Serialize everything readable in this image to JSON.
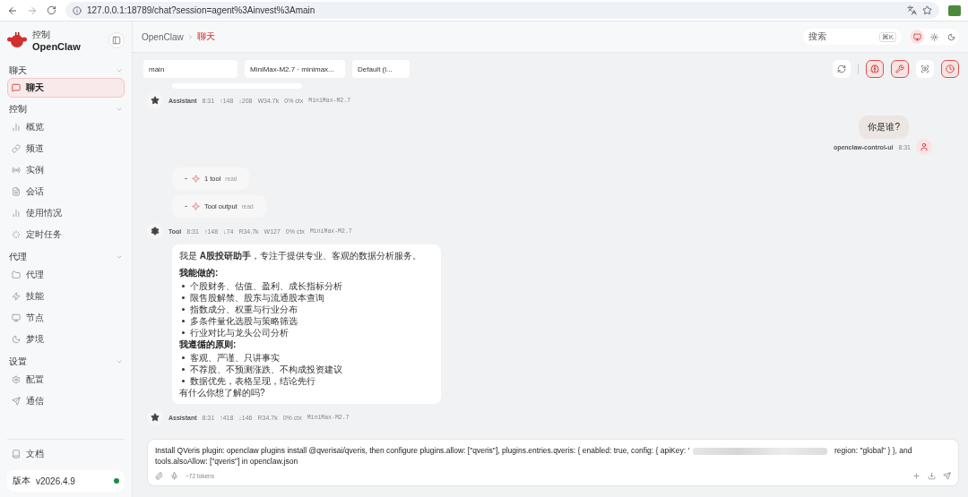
{
  "browser": {
    "url": "127.0.0.1:18789/chat?session=agent%3Ainvest%3Amain"
  },
  "brand": {
    "subtitle": "控制",
    "title": "OpenClaw"
  },
  "sidebar": {
    "groups": [
      {
        "label": "聊天",
        "expanded": true,
        "items": [
          {
            "label": "聊天",
            "selected": true
          }
        ]
      },
      {
        "label": "控制",
        "expanded": true,
        "items": [
          {
            "label": "概览",
            "selected": false
          },
          {
            "label": "频道",
            "selected": false
          },
          {
            "label": "实例",
            "selected": false
          },
          {
            "label": "会话",
            "selected": false
          },
          {
            "label": "使用情况",
            "selected": false
          },
          {
            "label": "定时任务",
            "selected": false
          }
        ]
      },
      {
        "label": "代理",
        "expanded": true,
        "items": [
          {
            "label": "代理",
            "selected": false
          },
          {
            "label": "技能",
            "selected": false
          },
          {
            "label": "节点",
            "selected": false
          },
          {
            "label": "梦境",
            "selected": false
          }
        ]
      },
      {
        "label": "设置",
        "expanded": true,
        "items": [
          {
            "label": "配置",
            "selected": false
          },
          {
            "label": "通信",
            "selected": false
          }
        ]
      }
    ],
    "docs": "文档",
    "version_label": "版本",
    "version": "v2026.4.9",
    "online": true
  },
  "header": {
    "breadcrumb": [
      "OpenClaw",
      "聊天"
    ],
    "search": {
      "placeholder": "搜索",
      "shortcut": "⌘K"
    },
    "theme_modes": [
      {
        "selected": true
      },
      {
        "selected": false
      },
      {
        "selected": false
      }
    ]
  },
  "toolbar": {
    "selects": [
      "main",
      "MiniMax-M2.7 · minimax...",
      "Default (l..."
    ],
    "buttons": [
      {
        "active": false
      },
      {
        "active": true
      },
      {
        "active": true
      },
      {
        "active": false
      },
      {
        "active": true
      }
    ]
  },
  "messages": [
    {
      "kind": "assistant_meta",
      "name": "Assistant",
      "stats": [
        "8:31",
        "↑148",
        "↓208",
        "W34.7k",
        "0% ctx"
      ],
      "model": "MiniMax-M2.7"
    },
    {
      "kind": "user",
      "text": "你是谁?",
      "name": "openclaw-control-ui",
      "time": "8:31"
    },
    {
      "kind": "tool_card",
      "label": "1 tool",
      "detail": "read"
    },
    {
      "kind": "tool_card",
      "label": "Tool output",
      "detail": "read"
    },
    {
      "kind": "tool_meta",
      "name": "Tool",
      "stats": [
        "8:31",
        "↑148",
        "↓74",
        "R34.7k",
        "W127",
        "0% ctx"
      ],
      "model": "MiniMax-M2.7"
    },
    {
      "kind": "answer",
      "intro": "我是 **A股投研助手**，专注于提供专业、客观的数据分析服务。",
      "sections": [
        {
          "heading": "我能做的:",
          "bullets": [
            "个股财务、估值、盈利、成长指标分析",
            "限售股解禁、股东与流通股本查询",
            "指数成分、权重与行业分布",
            "多条件量化选股与策略筛选",
            "行业对比与龙头公司分析"
          ]
        },
        {
          "heading": "我遵循的原则:",
          "bullets": [
            "客观、严谨、只讲事实",
            "不荐股、不预测涨跌、不构成投资建议",
            "数据优先，表格呈现，结论先行"
          ]
        }
      ],
      "outro": "有什么你想了解的吗?"
    },
    {
      "kind": "assistant_meta",
      "name": "Assistant",
      "stats": [
        "8:31",
        "↑418",
        "↓146",
        "R34.7k",
        "0% ctx"
      ],
      "model": "MiniMax-M2.7"
    }
  ],
  "composer": {
    "before_redaction": "Install QVeris plugin: openclaw plugins install @qverisai/qveris, then configure plugins.allow: [\"qveris\"], plugins.entries.qveris: { enabled: true, config: { apiKey: '",
    "after_redaction": "region: \"global\" } }, and tools.alsoAllow: [\"qveris\"] in openclaw.json",
    "tokens": "~72 tokens"
  }
}
